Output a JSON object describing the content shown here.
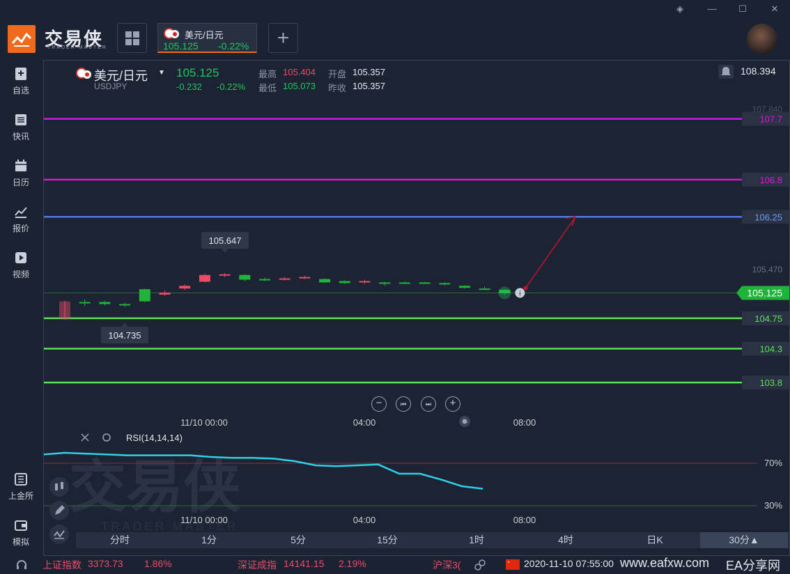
{
  "app": {
    "logo_text": "交易侠",
    "logo_sub": "TRADER MASTER"
  },
  "tab": {
    "name": "美元/日元",
    "price": "105.125",
    "change_pct": "-0.22%"
  },
  "sidebar": {
    "items": [
      {
        "label": "自选",
        "icon": "star-plus-icon"
      },
      {
        "label": "快讯",
        "icon": "news-icon"
      },
      {
        "label": "日历",
        "icon": "calendar-icon"
      },
      {
        "label": "报价",
        "icon": "chart-line-icon"
      },
      {
        "label": "视频",
        "icon": "video-icon"
      },
      {
        "label": "上金所",
        "icon": "exchange-icon"
      },
      {
        "label": "模拟",
        "icon": "wallet-icon"
      }
    ]
  },
  "header": {
    "symbol": "美元/日元",
    "code": "USDJPY",
    "price": "105.125",
    "change": "-0.232",
    "change_pct": "-0.22%",
    "high_label": "最高",
    "high": "105.404",
    "low_label": "最低",
    "low": "105.073",
    "open_label": "开盘",
    "open": "105.357",
    "prev_label": "昨收",
    "prev": "105.357",
    "right_value": "108.394"
  },
  "price_axis": {
    "ticks": [
      "107.840",
      "105.470"
    ],
    "current": "105.125"
  },
  "levels": [
    {
      "value": "107.7",
      "color": "#d81bd8"
    },
    {
      "value": "106.8",
      "color": "#d81bd8"
    },
    {
      "value": "106.25",
      "color": "#4a7fe8"
    },
    {
      "value": "104.75",
      "color": "#5fe05a"
    },
    {
      "value": "104.3",
      "color": "#5fe05a"
    },
    {
      "value": "103.8",
      "color": "#5fe05a"
    }
  ],
  "annotations": {
    "high_marker": "105.647",
    "low_marker": "104.735"
  },
  "time_axis": [
    "11/10 00:00",
    "04:00",
    "08:00"
  ],
  "rsi": {
    "label": "RSI(14,14,14)",
    "levels": [
      "70%",
      "30%"
    ],
    "time_axis": [
      "11/10 00:00",
      "04:00",
      "08:00"
    ]
  },
  "watermark": {
    "text": "交易侠",
    "sub": "TRADER MASTER"
  },
  "timeframes": [
    "分时",
    "1分",
    "5分",
    "15分",
    "1时",
    "4时",
    "日K",
    "30分▲"
  ],
  "status": {
    "idx1_name": "上证指数",
    "idx1_val": "3373.73",
    "idx1_pct": "1.86%",
    "idx2_name": "深证成指",
    "idx2_val": "14141.15",
    "idx2_pct": "2.19%",
    "idx3_name": "沪深3(",
    "datetime": "2020-11-10 07:55:00",
    "site": "www.eafxw.com",
    "brand": "EA分享网"
  },
  "chart_data": {
    "type": "candlestick",
    "current_price": 105.125,
    "candles": [
      {
        "o": 105.0,
        "c": 104.74,
        "h": 105.01,
        "l": 104.73
      },
      {
        "o": 104.98,
        "c": 104.99,
        "h": 105.03,
        "l": 104.93
      },
      {
        "o": 104.96,
        "c": 104.99,
        "h": 105.01,
        "l": 104.94
      },
      {
        "o": 104.95,
        "c": 104.96,
        "h": 104.98,
        "l": 104.92
      },
      {
        "o": 105.0,
        "c": 105.18,
        "h": 105.19,
        "l": 104.99
      },
      {
        "o": 105.13,
        "c": 105.1,
        "h": 105.16,
        "l": 105.08
      },
      {
        "o": 105.23,
        "c": 105.19,
        "h": 105.25,
        "l": 105.17
      },
      {
        "o": 105.39,
        "c": 105.29,
        "h": 105.41,
        "l": 105.28
      },
      {
        "o": 105.4,
        "c": 105.38,
        "h": 105.42,
        "l": 105.36
      },
      {
        "o": 105.32,
        "c": 105.39,
        "h": 105.4,
        "l": 105.3
      },
      {
        "o": 105.31,
        "c": 105.33,
        "h": 105.35,
        "l": 105.3
      },
      {
        "o": 105.34,
        "c": 105.32,
        "h": 105.36,
        "l": 105.31
      },
      {
        "o": 105.36,
        "c": 105.35,
        "h": 105.38,
        "l": 105.33
      },
      {
        "o": 105.28,
        "c": 105.33,
        "h": 105.34,
        "l": 105.27
      },
      {
        "o": 105.27,
        "c": 105.3,
        "h": 105.31,
        "l": 105.26
      },
      {
        "o": 105.3,
        "c": 105.29,
        "h": 105.32,
        "l": 105.26
      },
      {
        "o": 105.27,
        "c": 105.28,
        "h": 105.29,
        "l": 105.23
      },
      {
        "o": 105.27,
        "c": 105.28,
        "h": 105.29,
        "l": 105.26
      },
      {
        "o": 105.27,
        "c": 105.28,
        "h": 105.29,
        "l": 105.26
      },
      {
        "o": 105.25,
        "c": 105.27,
        "h": 105.28,
        "l": 105.24
      },
      {
        "o": 105.2,
        "c": 105.23,
        "h": 105.24,
        "l": 105.19
      },
      {
        "o": 105.18,
        "c": 105.19,
        "h": 105.22,
        "l": 105.17
      },
      {
        "o": 105.12,
        "c": 105.17,
        "h": 105.18,
        "l": 105.1
      }
    ],
    "rsi": [
      58,
      60,
      59,
      58,
      57,
      57,
      57,
      57,
      55,
      54,
      54,
      53,
      50,
      45,
      44,
      45,
      46,
      35,
      35,
      28,
      20,
      17
    ],
    "rsi_levels": [
      70,
      30
    ],
    "colors": {
      "up": "#22b33a",
      "down": "#e84d68",
      "rsi": "#2fd0e8"
    }
  }
}
